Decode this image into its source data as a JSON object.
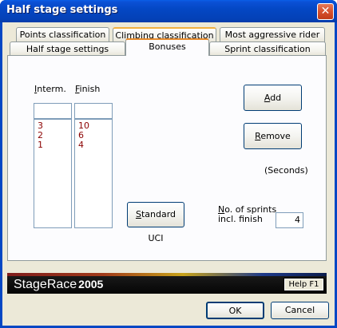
{
  "window": {
    "title": "Half stage settings",
    "close_glyph": "✕"
  },
  "tabs": {
    "row1": [
      {
        "label": "Points classification"
      },
      {
        "label": "Climbing classification"
      },
      {
        "label": "Most aggressive rider"
      }
    ],
    "row2": [
      {
        "label": "Half stage settings"
      },
      {
        "label": "Bonuses",
        "selected": true
      },
      {
        "label": "Sprint classification"
      }
    ]
  },
  "bonuses": {
    "interm_label_prefix": "I",
    "interm_label_rest": "nterm.",
    "finish_label_prefix": "F",
    "finish_label_rest": "inish",
    "interm_input_value": "",
    "finish_input_value": "",
    "interm_values": [
      "3",
      "2",
      "1"
    ],
    "finish_values": [
      "10",
      "6",
      "4"
    ],
    "add_prefix": "A",
    "add_rest": "dd",
    "remove_prefix": "R",
    "remove_rest": "emove",
    "seconds_note": "(Seconds)",
    "standard_uci_prefix": "S",
    "standard_uci_rest": "tandard UCI",
    "sprints_label_prefix": "N",
    "sprints_label_line1_rest": "o. of sprints",
    "sprints_label_line2": "incl. finish",
    "sprints_value": "4"
  },
  "footer": {
    "logo_text": "StageRace",
    "logo_year": "2005",
    "help_label": "Help F1"
  },
  "dialog_buttons": {
    "ok_label": "OK",
    "cancel_label": "Cancel"
  },
  "colors": {
    "title_bar": "#0447c4",
    "dialog_bg": "#ece9d8",
    "panel_bg": "#fcfcfe",
    "list_text": "#8b0000",
    "selected_tab_accent": "#e68b2c"
  }
}
